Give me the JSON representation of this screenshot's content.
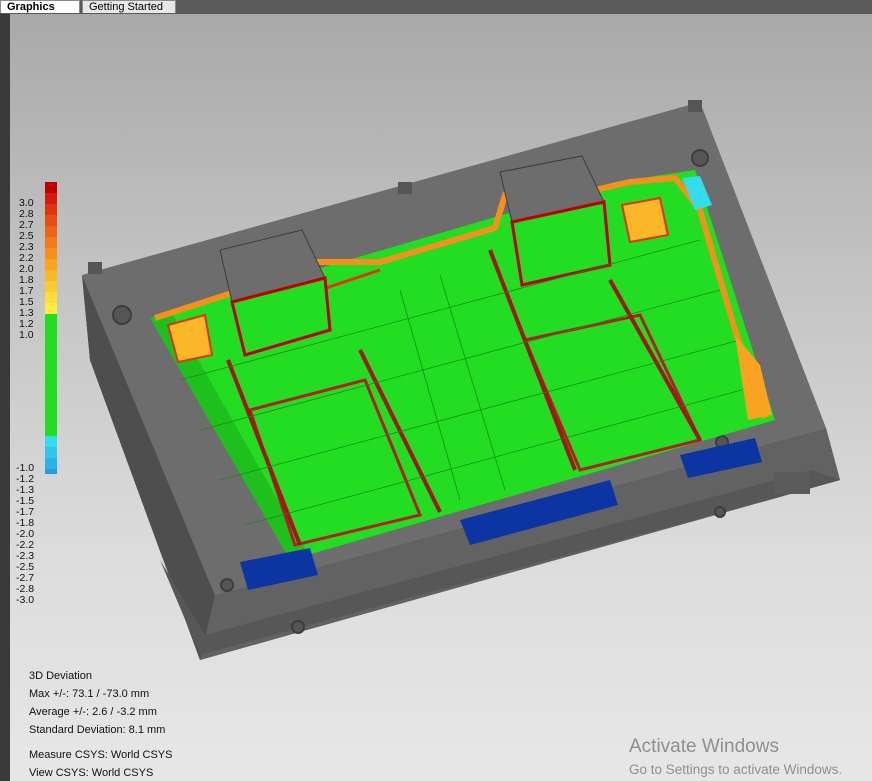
{
  "tabs": [
    {
      "label": "Graphics",
      "active": true
    },
    {
      "label": "Getting Started",
      "active": false
    }
  ],
  "legend": {
    "labels": [
      "3.0",
      "2.8",
      "2.7",
      "2.5",
      "2.3",
      "2.2",
      "2.0",
      "1.8",
      "1.7",
      "1.5",
      "1.3",
      "1.2",
      "1.0",
      "-1.0",
      "-1.2",
      "-1.3",
      "-1.5",
      "-1.7",
      "-1.8",
      "-2.0",
      "-2.2",
      "-2.3",
      "-2.5",
      "-2.7",
      "-2.8",
      "-3.0"
    ],
    "colors": {
      "positive": [
        "#c00000",
        "#d81a0a",
        "#e0340c",
        "#e84e10",
        "#ee6414",
        "#f27a18",
        "#f5901c",
        "#f8a420",
        "#fab828",
        "#fccb30",
        "#fdde38",
        "#ffee40"
      ],
      "nominal": "#22dd22",
      "negative": [
        "#33ddee",
        "#2ec8ee",
        "#28b2e8",
        "#229ce0",
        "#1c86d6",
        "#1870cc",
        "#145ac0",
        "#1046b2",
        "#0c34a2",
        "#082490",
        "#04167e",
        "#02086c"
      ]
    }
  },
  "info": {
    "title": "3D Deviation",
    "max": "Max +/-: 73.1 / -73.0 mm",
    "average": "Average +/-: 2.6 / -3.2 mm",
    "std": "Standard Deviation: 8.1 mm",
    "measure_csys": "Measure CSYS: World CSYS",
    "view_csys": "View CSYS: World CSYS"
  },
  "watermark": {
    "title": "Activate Windows",
    "subtitle": "Go to Settings to activate Windows."
  }
}
